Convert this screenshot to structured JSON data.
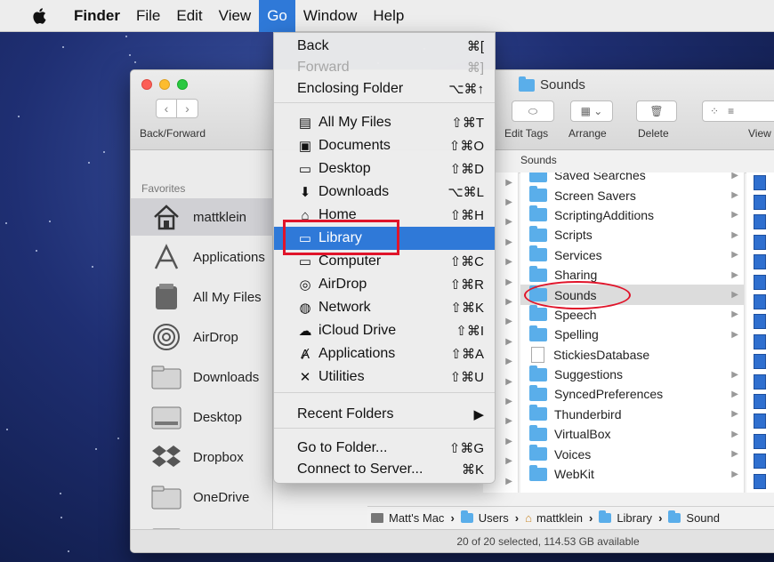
{
  "menubar": {
    "items": [
      "Finder",
      "File",
      "Edit",
      "View",
      "Go",
      "Window",
      "Help"
    ]
  },
  "window": {
    "title": "Sounds",
    "toolbar": {
      "back_forward_label": "Back/Forward",
      "edit_tags_label": "Edit Tags",
      "arrange_label": "Arrange",
      "delete_label": "Delete",
      "view_label": "View"
    },
    "column_header": "Sounds",
    "sidebar": {
      "heading": "Favorites",
      "items": [
        "mattklein",
        "Applications",
        "All My Files",
        "AirDrop",
        "Downloads",
        "Desktop",
        "Dropbox",
        "OneDrive"
      ]
    },
    "library_column": [
      {
        "name": "Saved Searches",
        "folder": true,
        "arrow": true
      },
      {
        "name": "Screen Savers",
        "folder": true,
        "arrow": true
      },
      {
        "name": "ScriptingAdditions",
        "folder": true,
        "arrow": true
      },
      {
        "name": "Scripts",
        "folder": true,
        "arrow": true
      },
      {
        "name": "Services",
        "folder": true,
        "arrow": true
      },
      {
        "name": "Sharing",
        "folder": true,
        "arrow": true
      },
      {
        "name": "Sounds",
        "folder": true,
        "arrow": true,
        "selected": true
      },
      {
        "name": "Speech",
        "folder": true,
        "arrow": true
      },
      {
        "name": "Spelling",
        "folder": true,
        "arrow": true
      },
      {
        "name": "StickiesDatabase",
        "folder": false,
        "arrow": false
      },
      {
        "name": "Suggestions",
        "folder": true,
        "arrow": true
      },
      {
        "name": "SyncedPreferences",
        "folder": true,
        "arrow": true
      },
      {
        "name": "Thunderbird",
        "folder": true,
        "arrow": true
      },
      {
        "name": "VirtualBox",
        "folder": true,
        "arrow": true
      },
      {
        "name": "Voices",
        "folder": true,
        "arrow": true
      },
      {
        "name": "WebKit",
        "folder": true,
        "arrow": true
      }
    ],
    "path_bar": [
      "Matt's Mac",
      "Users",
      "mattklein",
      "Library",
      "Sound"
    ],
    "status": "20 of 20 selected, 114.53 GB available"
  },
  "go_menu": {
    "items": [
      {
        "label": "Back",
        "shortcut": "⌘[",
        "icon": "",
        "disabled": false
      },
      {
        "label": "Forward",
        "shortcut": "⌘]",
        "icon": "",
        "disabled": true
      },
      {
        "label": "Enclosing Folder",
        "shortcut": "⌥⌘↑",
        "icon": "",
        "disabled": false
      },
      {
        "label": "All My Files",
        "shortcut": "⇧⌘T",
        "icon": "all-files-icon"
      },
      {
        "label": "Documents",
        "shortcut": "⇧⌘O",
        "icon": "documents-icon"
      },
      {
        "label": "Desktop",
        "shortcut": "⇧⌘D",
        "icon": "desktop-icon"
      },
      {
        "label": "Downloads",
        "shortcut": "⌥⌘L",
        "icon": "downloads-icon"
      },
      {
        "label": "Home",
        "shortcut": "⇧⌘H",
        "icon": "home-icon"
      },
      {
        "label": "Library",
        "shortcut": "",
        "icon": "library-folder-icon",
        "highlighted": true
      },
      {
        "label": "Computer",
        "shortcut": "⇧⌘C",
        "icon": "computer-icon"
      },
      {
        "label": "AirDrop",
        "shortcut": "⇧⌘R",
        "icon": "airdrop-icon"
      },
      {
        "label": "Network",
        "shortcut": "⇧⌘K",
        "icon": "network-icon"
      },
      {
        "label": "iCloud Drive",
        "shortcut": "⇧⌘I",
        "icon": "cloud-icon"
      },
      {
        "label": "Applications",
        "shortcut": "⇧⌘A",
        "icon": "applications-icon"
      },
      {
        "label": "Utilities",
        "shortcut": "⇧⌘U",
        "icon": "utilities-icon"
      },
      {
        "label": "Recent Folders",
        "shortcut": "▶",
        "icon": ""
      },
      {
        "label": "Go to Folder...",
        "shortcut": "⇧⌘G",
        "icon": ""
      },
      {
        "label": "Connect to Server...",
        "shortcut": "⌘K",
        "icon": ""
      }
    ]
  },
  "colors": {
    "menu_highlight": "#2f79d8",
    "annotation_red": "#e0142a",
    "folder_blue": "#5aaeea"
  }
}
